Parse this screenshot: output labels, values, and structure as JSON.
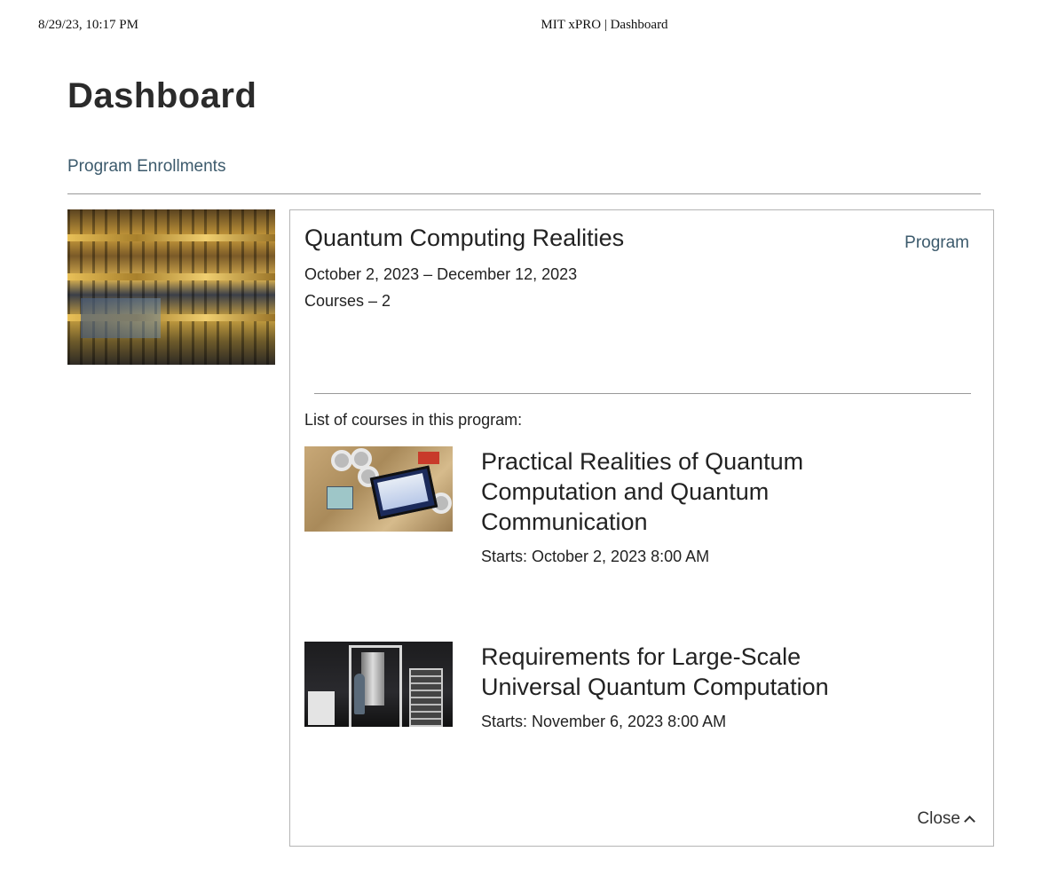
{
  "print_header": {
    "datetime": "8/29/23, 10:17 PM",
    "title": "MIT xPRO | Dashboard"
  },
  "page": {
    "title": "Dashboard",
    "section_link": "Program Enrollments"
  },
  "program": {
    "name": "Quantum Computing Realities",
    "type_label": "Program",
    "dates": "October 2, 2023 – December 12, 2023",
    "courses_count": "Courses – 2",
    "courses_heading": "List of courses in this program:",
    "close_label": "Close"
  },
  "courses": [
    {
      "title": "Practical Realities of Quantum Computation and Quantum Communication",
      "start": "Starts: October 2, 2023 8:00 AM"
    },
    {
      "title": "Requirements for Large-Scale Universal Quantum Computation",
      "start": "Starts: November 6, 2023 8:00 AM"
    }
  ],
  "colors": {
    "link": "#3c5a6c",
    "text": "#222222",
    "border": "#b5b5b5"
  }
}
